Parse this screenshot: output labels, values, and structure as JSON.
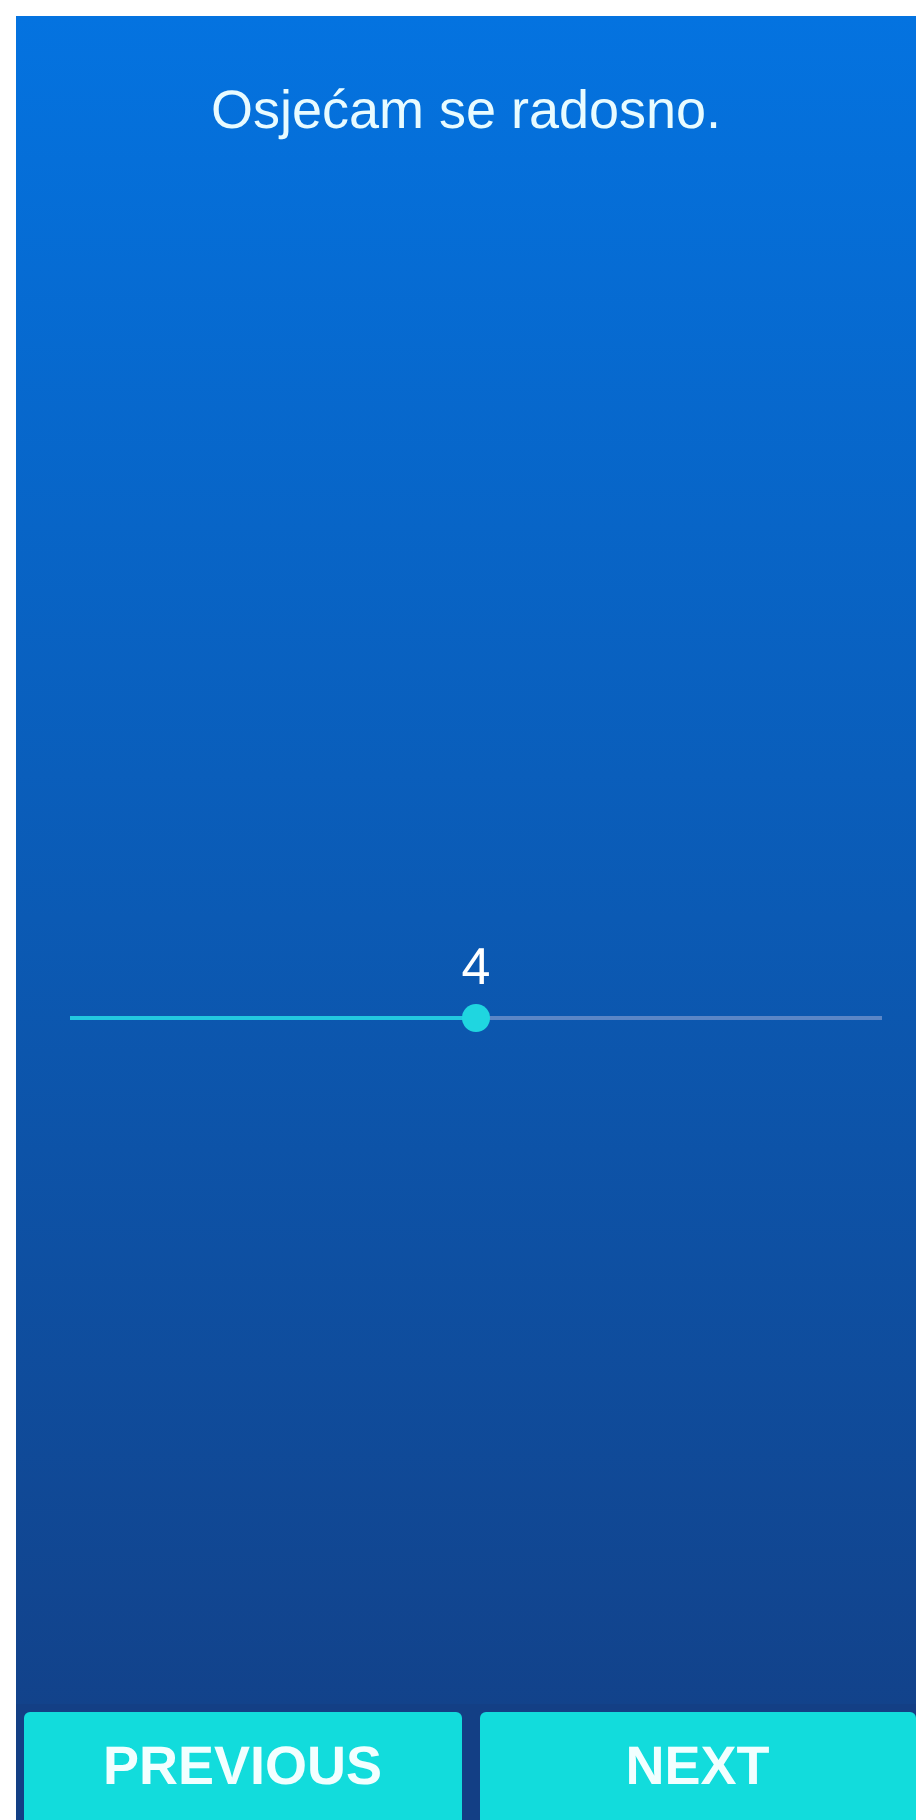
{
  "statement": "Osjećam se radosno.",
  "slider": {
    "value": "4",
    "level": 0.5
  },
  "buttons": [
    {
      "label": "PREVIOUS"
    },
    {
      "label": "NEXT"
    }
  ]
}
